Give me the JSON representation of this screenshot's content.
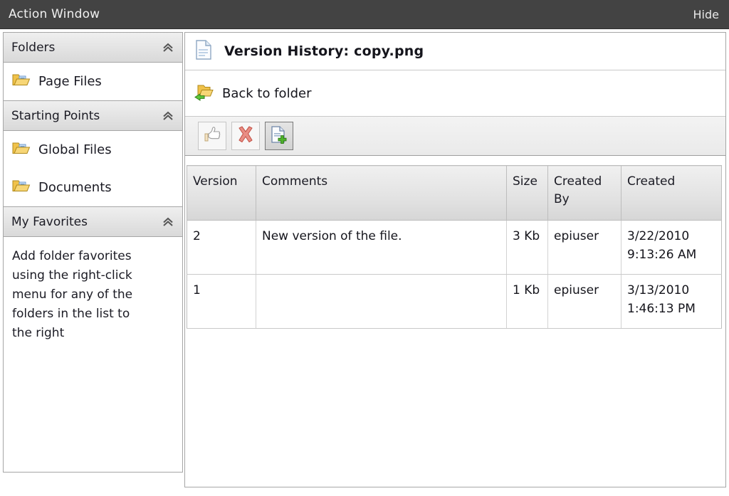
{
  "window": {
    "title": "Action Window",
    "hide_label": "Hide"
  },
  "sidebar": {
    "sections": [
      {
        "name": "folders",
        "title": "Folders",
        "collapse_icon": "chevron-double-up-icon",
        "items": [
          {
            "label": "Page Files",
            "icon": "folder-icon"
          }
        ]
      },
      {
        "name": "starting-points",
        "title": "Starting Points",
        "collapse_icon": "chevron-double-up-icon",
        "items": [
          {
            "label": "Global Files",
            "icon": "folder-icon"
          },
          {
            "label": "Documents",
            "icon": "folder-icon"
          }
        ]
      },
      {
        "name": "my-favorites",
        "title": "My Favorites",
        "collapse_icon": "chevron-double-up-icon",
        "empty_text": "Add folder favorites using the right-click menu for any of the folders in the list to the right"
      }
    ]
  },
  "main": {
    "header": {
      "icon": "document-icon",
      "title": "Version History: copy.png"
    },
    "back_link": {
      "icon": "folder-back-arrow-icon",
      "label": "Back to folder"
    },
    "toolbar": {
      "buttons": [
        {
          "name": "publish-button",
          "icon": "thumbs-up-icon",
          "state": "disabled"
        },
        {
          "name": "delete-button",
          "icon": "red-x-icon",
          "state": "normal"
        },
        {
          "name": "new-version-button",
          "icon": "document-add-icon",
          "state": "active"
        }
      ]
    },
    "table": {
      "columns": [
        "Version",
        "Comments",
        "Size",
        "Created By",
        "Created"
      ],
      "rows": [
        {
          "version": "2",
          "comments": "New version of the file.",
          "size": "3 Kb",
          "created_by": "epiuser",
          "created": "3/22/2010 9:13:26 AM"
        },
        {
          "version": "1",
          "comments": "",
          "size": "1 Kb",
          "created_by": "epiuser",
          "created": "3/13/2010 1:46:13 PM"
        }
      ]
    }
  },
  "colors": {
    "titlebar_bg": "#434343",
    "titlebar_text": "#f0f0f0",
    "section_header_bg": "#e4e4e4",
    "border": "#a6a6a6",
    "folder_gold": "#e8b33a",
    "folder_blue": "#6c9bd2",
    "green_arrow": "#49b02e",
    "red_x": "#e38b82"
  }
}
